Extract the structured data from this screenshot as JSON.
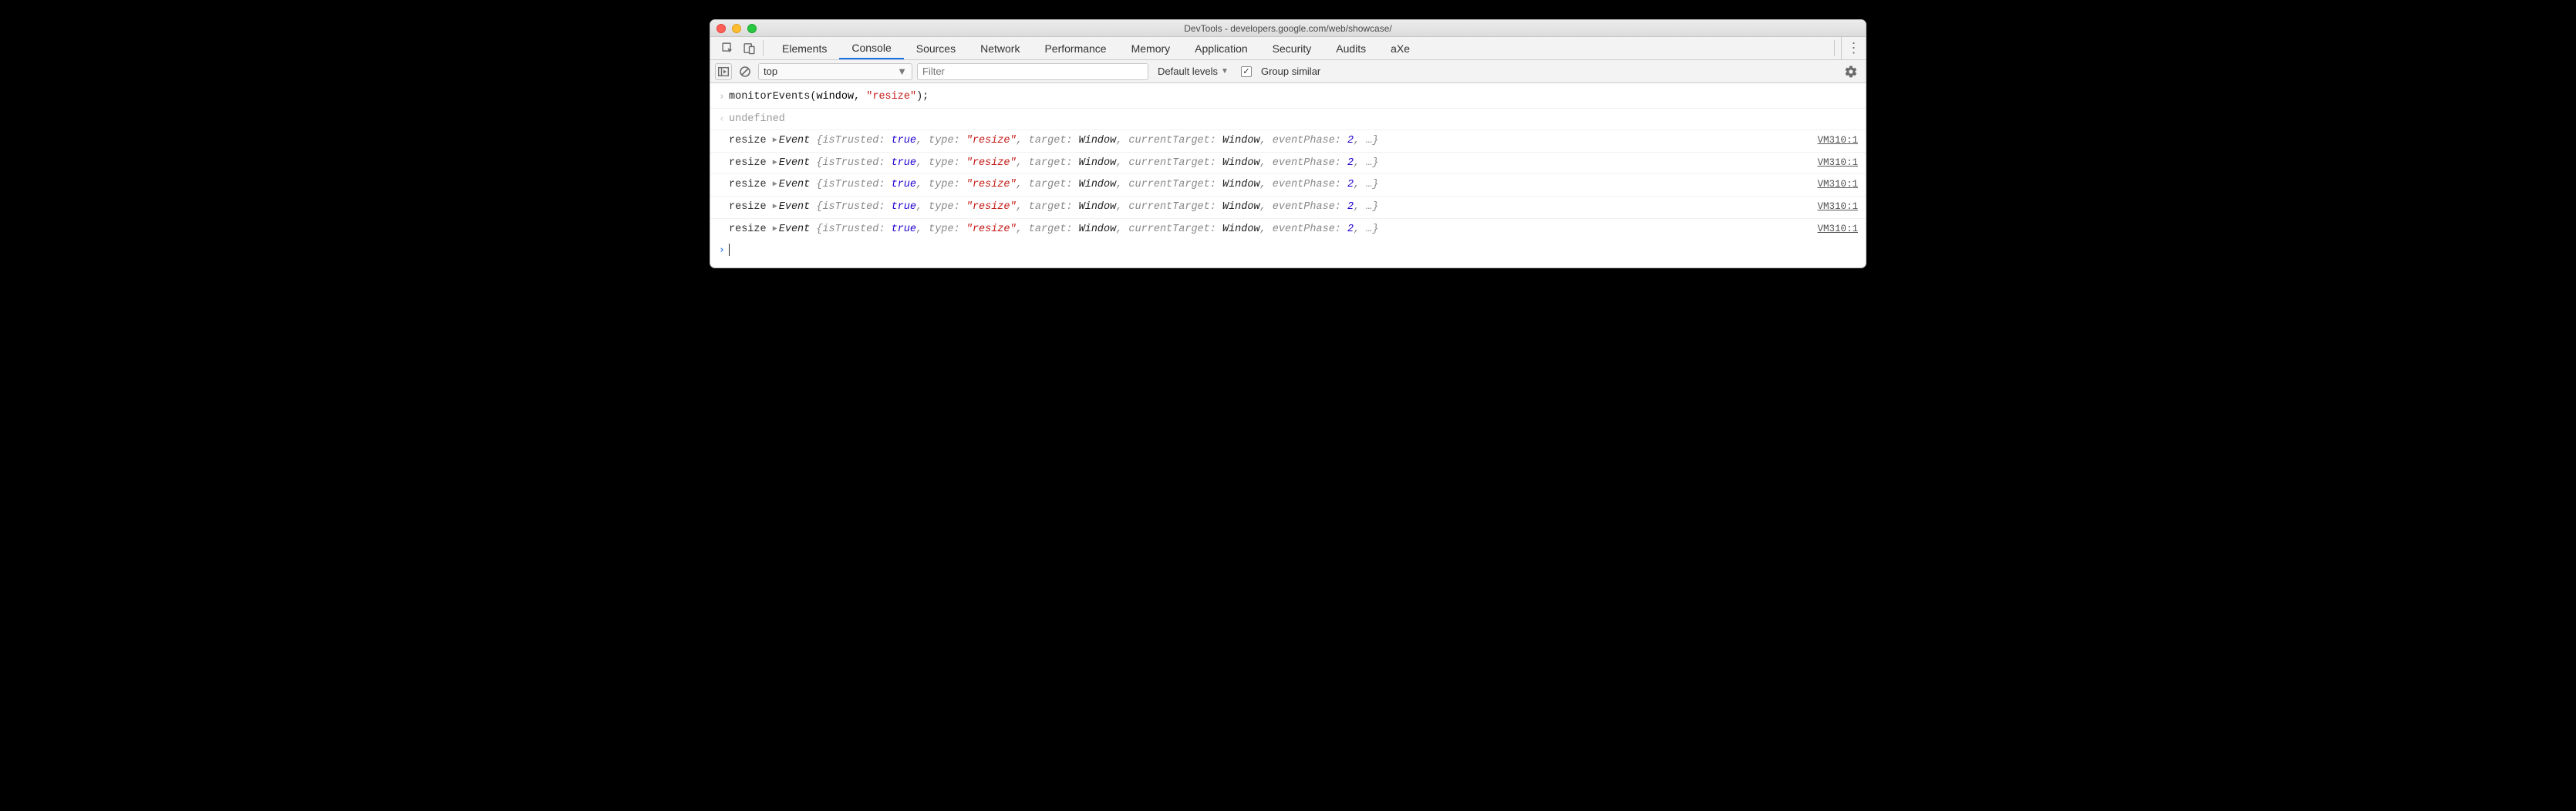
{
  "window": {
    "title": "DevTools - developers.google.com/web/showcase/"
  },
  "tabs": {
    "items": [
      "Elements",
      "Console",
      "Sources",
      "Network",
      "Performance",
      "Memory",
      "Application",
      "Security",
      "Audits",
      "aXe"
    ],
    "active": "Console"
  },
  "toolbar": {
    "context": "top",
    "filter_placeholder": "Filter",
    "levels_label": "Default levels",
    "group_label": "Group similar",
    "group_checked": true
  },
  "console": {
    "input_cmd": {
      "fn": "monitorEvents",
      "arg1": "window",
      "arg2": "\"resize\""
    },
    "return_value": "undefined",
    "events": [
      {
        "name": "resize",
        "isTrusted": "true",
        "type": "\"resize\"",
        "target": "Window",
        "currentTarget": "Window",
        "eventPhase": "2",
        "source": "VM310:1"
      },
      {
        "name": "resize",
        "isTrusted": "true",
        "type": "\"resize\"",
        "target": "Window",
        "currentTarget": "Window",
        "eventPhase": "2",
        "source": "VM310:1"
      },
      {
        "name": "resize",
        "isTrusted": "true",
        "type": "\"resize\"",
        "target": "Window",
        "currentTarget": "Window",
        "eventPhase": "2",
        "source": "VM310:1"
      },
      {
        "name": "resize",
        "isTrusted": "true",
        "type": "\"resize\"",
        "target": "Window",
        "currentTarget": "Window",
        "eventPhase": "2",
        "source": "VM310:1"
      },
      {
        "name": "resize",
        "isTrusted": "true",
        "type": "\"resize\"",
        "target": "Window",
        "currentTarget": "Window",
        "eventPhase": "2",
        "source": "VM310:1"
      }
    ]
  }
}
